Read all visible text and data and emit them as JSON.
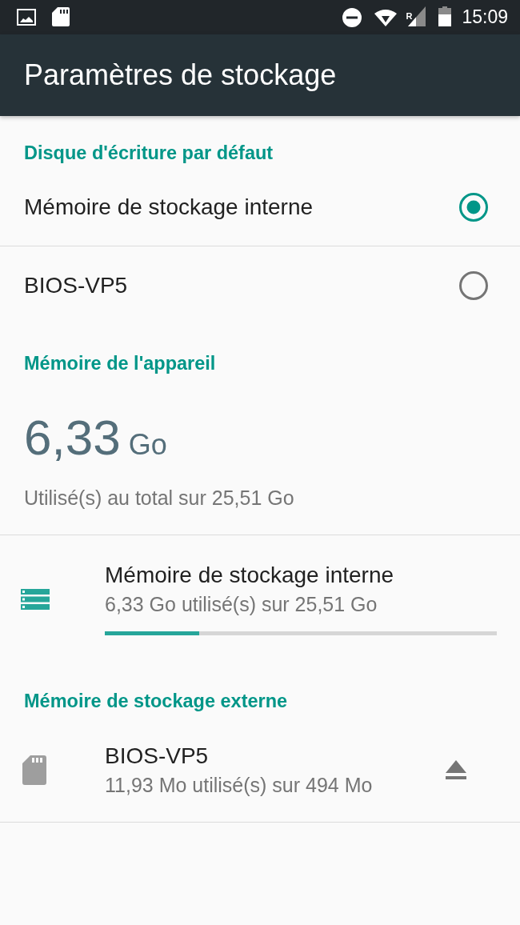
{
  "status_bar": {
    "roaming": "R",
    "time": "15:09"
  },
  "app_bar": {
    "title": "Paramètres de stockage"
  },
  "default_disk": {
    "header": "Disque d'écriture par défaut",
    "options": [
      {
        "label": "Mémoire de stockage interne",
        "selected": true
      },
      {
        "label": "BIOS-VP5",
        "selected": false
      }
    ]
  },
  "device_memory": {
    "header": "Mémoire de l'appareil",
    "used_value": "6,33",
    "used_unit": "Go",
    "caption": "Utilisé(s) au total sur 25,51 Go",
    "volumes": [
      {
        "kind": "internal",
        "name": "Mémoire de stockage interne",
        "summary": "6,33 Go utilisé(s) sur 25,51 Go",
        "level": 0.24
      }
    ]
  },
  "external_storage": {
    "header": "Mémoire de stockage externe",
    "volumes": [
      {
        "kind": "sd",
        "name": "BIOS-VP5",
        "summary": "11,93 Mo utilisé(s) sur 494 Mo",
        "ejectable": true
      }
    ]
  }
}
